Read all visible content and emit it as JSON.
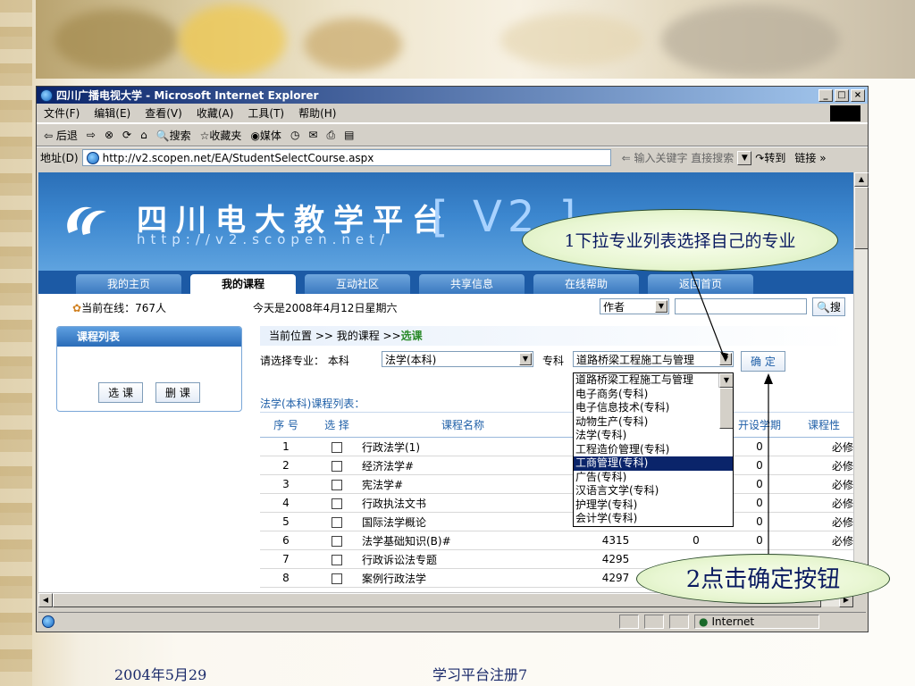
{
  "window": {
    "title": "四川广播电视大学 - Microsoft Internet Explorer",
    "minimize": "_",
    "maximize": "□",
    "close": "×"
  },
  "menu": [
    "文件(F)",
    "编辑(E)",
    "查看(V)",
    "收藏(A)",
    "工具(T)",
    "帮助(H)"
  ],
  "toolbar": {
    "back": "⇦ 后退",
    "forward": "⇨",
    "search": "搜索",
    "favorites": "收藏夹",
    "media": "媒体"
  },
  "address": {
    "label": "地址(D)",
    "url": "http://v2.scopen.net/EA/StudentSelectCourse.aspx",
    "search_hint": "⇐ 输入关键字 直接搜索",
    "go": "转到",
    "links": "链接"
  },
  "site": {
    "title": "四川电大教学平台",
    "url": "http://v2.scopen.net/",
    "version": "[ V2 ]"
  },
  "nav": [
    "我的主页",
    "我的课程",
    "互动社区",
    "共享信息",
    "在线帮助",
    "返回首页"
  ],
  "nav_active": "我的课程",
  "info": {
    "online": "当前在线：767人",
    "today": "今天是2008年4月12日星期六",
    "search_type": "作者",
    "search_button": "搜"
  },
  "leftpanel": {
    "title": "课程列表",
    "select_button": "选 课",
    "delete_button": "删 课"
  },
  "crumb": {
    "prefix": "当前位置 >> 我的课程 >>",
    "current": "选课"
  },
  "picker": {
    "label": "请选择专业：",
    "level1": "本科",
    "major1": "法学(本科)",
    "level2": "专科",
    "major2": "道路桥梁工程施工与管理",
    "confirm": "确 定"
  },
  "dropdown_options": [
    "道路桥梁工程施工与管理",
    "电子商务(专科)",
    "电子信息技术(专科)",
    "动物生产(专科)",
    "法学(专科)",
    "工程造价管理(专科)",
    "工商管理(专科)",
    "广告(专科)",
    "汉语言文学(专科)",
    "护理学(专科)",
    "会计学(专科)"
  ],
  "dropdown_selected": "工商管理(专科)",
  "course_list_title": "法学(本科)课程列表：",
  "table": {
    "headers": [
      "序 号",
      "选 择",
      "课程名称",
      "",
      "",
      "开设学期",
      "课程性"
    ],
    "rows": [
      [
        "1",
        "行政法学(1)",
        "",
        "",
        "0",
        "必修"
      ],
      [
        "2",
        "经济法学#",
        "",
        "",
        "0",
        "必修"
      ],
      [
        "3",
        "宪法学#",
        "",
        "",
        "0",
        "必修"
      ],
      [
        "4",
        "行政执法文书",
        "",
        "",
        "0",
        "必修"
      ],
      [
        "5",
        "国际法学概论",
        "4296",
        "0",
        "0",
        "必修"
      ],
      [
        "6",
        "法学基础知识(B)#",
        "4315",
        "0",
        "0",
        "必修"
      ],
      [
        "7",
        "行政诉讼法专题",
        "4295",
        "",
        "",
        ""
      ],
      [
        "8",
        "案例行政法学",
        "4297",
        "",
        "",
        ""
      ]
    ]
  },
  "status": {
    "zone": "Internet"
  },
  "callouts": {
    "step1": "1下拉专业列表选择自己的专业",
    "step2": "2点击确定按钮"
  },
  "footer": {
    "date": "2004年5月29",
    "caption": "学习平台注册7"
  }
}
